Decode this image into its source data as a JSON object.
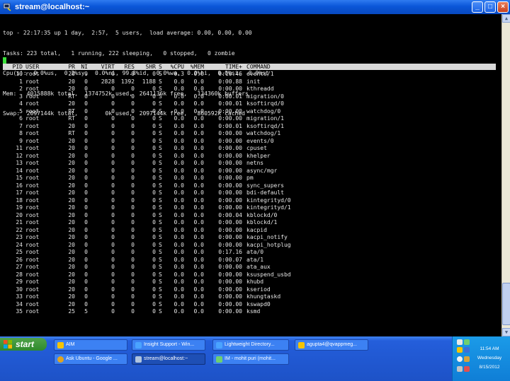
{
  "window": {
    "title": "stream@localhost:~"
  },
  "summary": [
    "top - 22:17:35 up 1 day,  2:57,  5 users,  load average: 0.00, 0.00, 0.00",
    "Tasks: 223 total,   1 running, 222 sleeping,   0 stopped,   0 zombie",
    "Cpu(s):  0.0%us,  0.2%sy,  0.0%ni, 99.8%id,  0.0%wa,  0.0%hi,  0.0%si,  0.0%st",
    "Mem:   4015888k total,  1374752k used,  2641136k free,   134360k buffers",
    "Swap:  2097144k total,        0k used,  2097144k free,   860592k cached"
  ],
  "columns": {
    "pid": "PID",
    "user": "USER",
    "pr": "PR",
    "ni": "NI",
    "virt": "VIRT",
    "res": "RES",
    "shr": "SHR",
    "s": "S",
    "cpu": "%CPU",
    "mem": "%MEM",
    "time": "TIME+",
    "cmd": "COMMAND"
  },
  "processes": [
    {
      "pid": "10",
      "user": "root",
      "pr": "20",
      "ni": "0",
      "virt": "0",
      "res": "0",
      "shr": "0",
      "s": "S",
      "cpu": "0.3",
      "mem": "0.0",
      "time": "0:10.46",
      "cmd": "events/1"
    },
    {
      "pid": "1",
      "user": "root",
      "pr": "20",
      "ni": "0",
      "virt": "2828",
      "res": "1392",
      "shr": "1188",
      "s": "S",
      "cpu": "0.0",
      "mem": "0.0",
      "time": "0:00.88",
      "cmd": "init"
    },
    {
      "pid": "2",
      "user": "root",
      "pr": "20",
      "ni": "0",
      "virt": "0",
      "res": "0",
      "shr": "0",
      "s": "S",
      "cpu": "0.0",
      "mem": "0.0",
      "time": "0:00.00",
      "cmd": "kthreadd"
    },
    {
      "pid": "3",
      "user": "root",
      "pr": "RT",
      "ni": "0",
      "virt": "0",
      "res": "0",
      "shr": "0",
      "s": "S",
      "cpu": "0.0",
      "mem": "0.0",
      "time": "0:00.01",
      "cmd": "migration/0"
    },
    {
      "pid": "4",
      "user": "root",
      "pr": "20",
      "ni": "0",
      "virt": "0",
      "res": "0",
      "shr": "0",
      "s": "S",
      "cpu": "0.0",
      "mem": "0.0",
      "time": "0:00.01",
      "cmd": "ksoftirqd/0"
    },
    {
      "pid": "5",
      "user": "root",
      "pr": "RT",
      "ni": "0",
      "virt": "0",
      "res": "0",
      "shr": "0",
      "s": "S",
      "cpu": "0.0",
      "mem": "0.0",
      "time": "0:00.00",
      "cmd": "watchdog/0"
    },
    {
      "pid": "6",
      "user": "root",
      "pr": "RT",
      "ni": "0",
      "virt": "0",
      "res": "0",
      "shr": "0",
      "s": "S",
      "cpu": "0.0",
      "mem": "0.0",
      "time": "0:00.00",
      "cmd": "migration/1"
    },
    {
      "pid": "7",
      "user": "root",
      "pr": "20",
      "ni": "0",
      "virt": "0",
      "res": "0",
      "shr": "0",
      "s": "S",
      "cpu": "0.0",
      "mem": "0.0",
      "time": "0:00.01",
      "cmd": "ksoftirqd/1"
    },
    {
      "pid": "8",
      "user": "root",
      "pr": "RT",
      "ni": "0",
      "virt": "0",
      "res": "0",
      "shr": "0",
      "s": "S",
      "cpu": "0.0",
      "mem": "0.0",
      "time": "0:00.00",
      "cmd": "watchdog/1"
    },
    {
      "pid": "9",
      "user": "root",
      "pr": "20",
      "ni": "0",
      "virt": "0",
      "res": "0",
      "shr": "0",
      "s": "S",
      "cpu": "0.0",
      "mem": "0.0",
      "time": "0:00.00",
      "cmd": "events/0"
    },
    {
      "pid": "11",
      "user": "root",
      "pr": "20",
      "ni": "0",
      "virt": "0",
      "res": "0",
      "shr": "0",
      "s": "S",
      "cpu": "0.0",
      "mem": "0.0",
      "time": "0:00.00",
      "cmd": "cpuset"
    },
    {
      "pid": "12",
      "user": "root",
      "pr": "20",
      "ni": "0",
      "virt": "0",
      "res": "0",
      "shr": "0",
      "s": "S",
      "cpu": "0.0",
      "mem": "0.0",
      "time": "0:00.00",
      "cmd": "khelper"
    },
    {
      "pid": "13",
      "user": "root",
      "pr": "20",
      "ni": "0",
      "virt": "0",
      "res": "0",
      "shr": "0",
      "s": "S",
      "cpu": "0.0",
      "mem": "0.0",
      "time": "0:00.00",
      "cmd": "netns"
    },
    {
      "pid": "14",
      "user": "root",
      "pr": "20",
      "ni": "0",
      "virt": "0",
      "res": "0",
      "shr": "0",
      "s": "S",
      "cpu": "0.0",
      "mem": "0.0",
      "time": "0:00.00",
      "cmd": "async/mgr"
    },
    {
      "pid": "15",
      "user": "root",
      "pr": "20",
      "ni": "0",
      "virt": "0",
      "res": "0",
      "shr": "0",
      "s": "S",
      "cpu": "0.0",
      "mem": "0.0",
      "time": "0:00.00",
      "cmd": "pm"
    },
    {
      "pid": "16",
      "user": "root",
      "pr": "20",
      "ni": "0",
      "virt": "0",
      "res": "0",
      "shr": "0",
      "s": "S",
      "cpu": "0.0",
      "mem": "0.0",
      "time": "0:00.00",
      "cmd": "sync_supers"
    },
    {
      "pid": "17",
      "user": "root",
      "pr": "20",
      "ni": "0",
      "virt": "0",
      "res": "0",
      "shr": "0",
      "s": "S",
      "cpu": "0.0",
      "mem": "0.0",
      "time": "0:00.00",
      "cmd": "bdi-default"
    },
    {
      "pid": "18",
      "user": "root",
      "pr": "20",
      "ni": "0",
      "virt": "0",
      "res": "0",
      "shr": "0",
      "s": "S",
      "cpu": "0.0",
      "mem": "0.0",
      "time": "0:00.00",
      "cmd": "kintegrityd/0"
    },
    {
      "pid": "19",
      "user": "root",
      "pr": "20",
      "ni": "0",
      "virt": "0",
      "res": "0",
      "shr": "0",
      "s": "S",
      "cpu": "0.0",
      "mem": "0.0",
      "time": "0:00.00",
      "cmd": "kintegrityd/1"
    },
    {
      "pid": "20",
      "user": "root",
      "pr": "20",
      "ni": "0",
      "virt": "0",
      "res": "0",
      "shr": "0",
      "s": "S",
      "cpu": "0.0",
      "mem": "0.0",
      "time": "0:00.04",
      "cmd": "kblockd/0"
    },
    {
      "pid": "21",
      "user": "root",
      "pr": "20",
      "ni": "0",
      "virt": "0",
      "res": "0",
      "shr": "0",
      "s": "S",
      "cpu": "0.0",
      "mem": "0.0",
      "time": "0:00.00",
      "cmd": "kblockd/1"
    },
    {
      "pid": "22",
      "user": "root",
      "pr": "20",
      "ni": "0",
      "virt": "0",
      "res": "0",
      "shr": "0",
      "s": "S",
      "cpu": "0.0",
      "mem": "0.0",
      "time": "0:00.00",
      "cmd": "kacpid"
    },
    {
      "pid": "23",
      "user": "root",
      "pr": "20",
      "ni": "0",
      "virt": "0",
      "res": "0",
      "shr": "0",
      "s": "S",
      "cpu": "0.0",
      "mem": "0.0",
      "time": "0:00.00",
      "cmd": "kacpi_notify"
    },
    {
      "pid": "24",
      "user": "root",
      "pr": "20",
      "ni": "0",
      "virt": "0",
      "res": "0",
      "shr": "0",
      "s": "S",
      "cpu": "0.0",
      "mem": "0.0",
      "time": "0:00.00",
      "cmd": "kacpi_hotplug"
    },
    {
      "pid": "25",
      "user": "root",
      "pr": "20",
      "ni": "0",
      "virt": "0",
      "res": "0",
      "shr": "0",
      "s": "S",
      "cpu": "0.0",
      "mem": "0.0",
      "time": "0:17.16",
      "cmd": "ata/0"
    },
    {
      "pid": "26",
      "user": "root",
      "pr": "20",
      "ni": "0",
      "virt": "0",
      "res": "0",
      "shr": "0",
      "s": "S",
      "cpu": "0.0",
      "mem": "0.0",
      "time": "0:00.07",
      "cmd": "ata/1"
    },
    {
      "pid": "27",
      "user": "root",
      "pr": "20",
      "ni": "0",
      "virt": "0",
      "res": "0",
      "shr": "0",
      "s": "S",
      "cpu": "0.0",
      "mem": "0.0",
      "time": "0:00.00",
      "cmd": "ata_aux"
    },
    {
      "pid": "28",
      "user": "root",
      "pr": "20",
      "ni": "0",
      "virt": "0",
      "res": "0",
      "shr": "0",
      "s": "S",
      "cpu": "0.0",
      "mem": "0.0",
      "time": "0:00.00",
      "cmd": "ksuspend_usbd"
    },
    {
      "pid": "29",
      "user": "root",
      "pr": "20",
      "ni": "0",
      "virt": "0",
      "res": "0",
      "shr": "0",
      "s": "S",
      "cpu": "0.0",
      "mem": "0.0",
      "time": "0:00.00",
      "cmd": "khubd"
    },
    {
      "pid": "30",
      "user": "root",
      "pr": "20",
      "ni": "0",
      "virt": "0",
      "res": "0",
      "shr": "0",
      "s": "S",
      "cpu": "0.0",
      "mem": "0.0",
      "time": "0:00.00",
      "cmd": "kseriod"
    },
    {
      "pid": "33",
      "user": "root",
      "pr": "20",
      "ni": "0",
      "virt": "0",
      "res": "0",
      "shr": "0",
      "s": "S",
      "cpu": "0.0",
      "mem": "0.0",
      "time": "0:00.00",
      "cmd": "khungtaskd"
    },
    {
      "pid": "34",
      "user": "root",
      "pr": "20",
      "ni": "0",
      "virt": "0",
      "res": "0",
      "shr": "0",
      "s": "S",
      "cpu": "0.0",
      "mem": "0.0",
      "time": "0:00.00",
      "cmd": "kswapd0"
    },
    {
      "pid": "35",
      "user": "root",
      "pr": "25",
      "ni": "5",
      "virt": "0",
      "res": "0",
      "shr": "0",
      "s": "S",
      "cpu": "0.0",
      "mem": "0.0",
      "time": "0:00.00",
      "cmd": "ksmd"
    }
  ],
  "taskbar": {
    "start_label": "start",
    "tasks": [
      {
        "label": "AIM",
        "icon": "aim-icon",
        "icon_color": "#f5c400"
      },
      {
        "label": "Insight Support - Win...",
        "icon": "ie-icon",
        "icon_color": "#4aa3ff"
      },
      {
        "label": "Lightweight Directory...",
        "icon": "ie-icon",
        "icon_color": "#4aa3ff"
      },
      {
        "label": "agupta4@qvappmeg...",
        "icon": "aim-icon",
        "icon_color": "#f5c400"
      },
      {
        "label": "Ask Ubuntu - Google ...",
        "icon": "chrome-icon",
        "icon_color": "#e0a320"
      },
      {
        "label": "stream@localhost:~",
        "icon": "putty-icon",
        "icon_color": "#b0c4de"
      },
      {
        "label": "IM - mohit puri (mohit...",
        "icon": "im-icon",
        "icon_color": "#6fcf6f"
      }
    ]
  },
  "clock": {
    "time": "11:54 AM",
    "day": "Wednesday",
    "date": "8/15/2012"
  },
  "colors": {
    "terminal_bg": "#000000",
    "terminal_fg": "#e6e6e6",
    "header_bg": "#d9d9d9",
    "cursor": "#3be03b",
    "taskbar": "#245edb"
  }
}
